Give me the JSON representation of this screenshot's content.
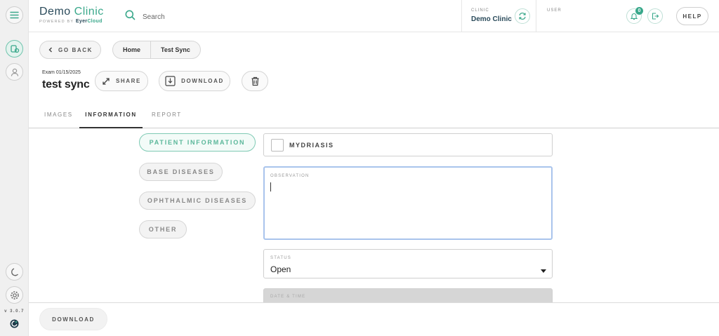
{
  "brand": {
    "title_main": "Demo",
    "title_accent": "Clinic",
    "powered_by": "POWERED BY",
    "product_main": "Eyer",
    "product_accent": "Cloud"
  },
  "search": {
    "label": "Search"
  },
  "header": {
    "clinic_label": "CLINIC",
    "clinic_name": "Demo Clinic",
    "user_label": "USER",
    "notification_count": "0",
    "help_label": "HELP"
  },
  "toolbar": {
    "go_back_label": "GO BACK",
    "breadcrumb": [
      "Home",
      "Test Sync"
    ],
    "share_label": "SHARE",
    "download_label": "DOWNLOAD"
  },
  "exam": {
    "date_label": "Exam 01/15/2025",
    "name": "test sync"
  },
  "tabs": [
    {
      "label": "IMAGES"
    },
    {
      "label": "INFORMATION"
    },
    {
      "label": "REPORT"
    }
  ],
  "sections": [
    {
      "label": "PATIENT INFORMATION"
    },
    {
      "label": "BASE DISEASES"
    },
    {
      "label": "OPHTHALMIC DISEASES"
    },
    {
      "label": "OTHER"
    }
  ],
  "form": {
    "mydriasis_label": "MYDRIASIS",
    "observation_label": "OBSERVATION",
    "observation_value": "",
    "status_label": "STATUS",
    "status_value": "Open",
    "date_time_label": "DATE & TIME"
  },
  "footer": {
    "download_label": "DOWNLOAD"
  },
  "sidebar": {
    "version": "v 3.0.7"
  },
  "colors": {
    "accent": "#3aa88b",
    "rail_bg": "#f0f0f0",
    "focus_border": "#a9c4ec"
  }
}
